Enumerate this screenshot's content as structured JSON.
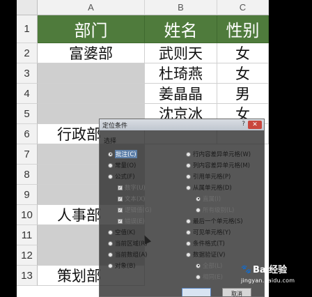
{
  "columns": [
    "A",
    "B",
    "C"
  ],
  "rows": [
    "1",
    "2",
    "3",
    "4",
    "5",
    "6",
    "7",
    "8",
    "9",
    "10",
    "11",
    "12",
    "13"
  ],
  "header": {
    "dept": "部门",
    "name": "姓名",
    "gender": "性别"
  },
  "data": [
    {
      "dept": "富婆部",
      "name": "武则天",
      "gender": "女"
    },
    {
      "dept": "",
      "name": "杜琦燕",
      "gender": "女"
    },
    {
      "dept": "",
      "name": "姜晶晶",
      "gender": "男"
    },
    {
      "dept": "",
      "name": "沈京冰",
      "gender": "女"
    }
  ],
  "merged_depts": {
    "d6": "行政部",
    "d10": "人事部",
    "d13": "策划部"
  },
  "dialog": {
    "title": "定位条件",
    "help": "?",
    "close": "✕",
    "group_label": "选择",
    "left_options": [
      {
        "label": "批注(C)",
        "selected": true
      },
      {
        "label": "常量(O)",
        "selected": false
      },
      {
        "label": "公式(F)",
        "selected": false
      },
      {
        "label": "空值(K)",
        "selected": false
      },
      {
        "label": "当前区域(R)",
        "selected": false
      },
      {
        "label": "当前数组(A)",
        "selected": false
      },
      {
        "label": "对象(B)",
        "selected": false
      }
    ],
    "formula_subs": [
      "数字(U)",
      "文本(X)",
      "逻辑值(G)",
      "错误(E)"
    ],
    "right_options": [
      "行内容差异单元格(W)",
      "列内容差异单元格(M)",
      "引用单元格(P)",
      "从属单元格(D)",
      "最后一个单元格(S)",
      "可见单元格(Y)",
      "条件格式(T)",
      "数据验证(V)"
    ],
    "dependents_subs": [
      "直属(I)",
      "所有级别(L)"
    ],
    "validation_subs": [
      "全部(L)",
      "相同(E)"
    ],
    "ok_label": "",
    "cancel_label": "取消"
  },
  "watermark": {
    "brand": "Bai经验",
    "url": "jingyan.baidu.com"
  }
}
